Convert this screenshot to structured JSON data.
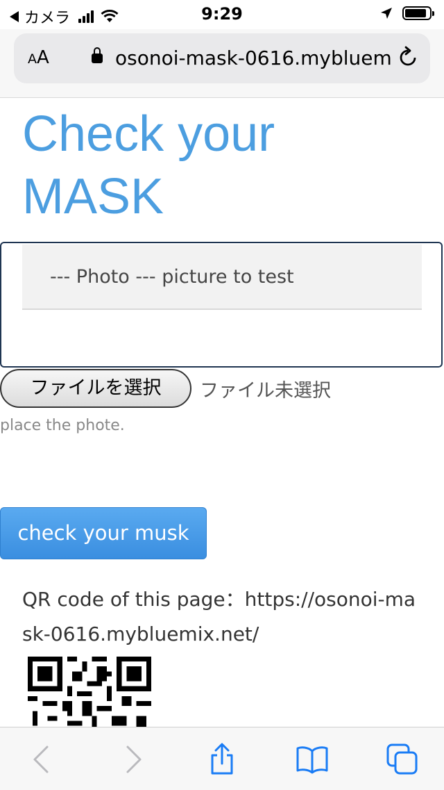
{
  "status_bar": {
    "back_app": "カメラ",
    "time": "9:29"
  },
  "browser": {
    "text_size_label": "AA",
    "url": "osonoi-mask-0616.mybluemix.net"
  },
  "page": {
    "title": "Check your MASK",
    "photo_select": {
      "selected": "--- Photo --- picture to test"
    },
    "file_input": {
      "button_label": "ファイルを選択",
      "status": "ファイル未選択"
    },
    "hint": "place the phote.",
    "check_button": "check your musk",
    "qr_text": "QR code of this page：https://osonoi-mask-0616.mybluemix.net/"
  },
  "colors": {
    "title": "#4c9ee0",
    "button": "#4a9ae6",
    "safari_blue": "#1a7cf5",
    "border": "#1f3552"
  },
  "toolbar": {
    "icons": [
      "back-icon",
      "forward-icon",
      "share-icon",
      "bookmarks-icon",
      "tabs-icon"
    ]
  }
}
